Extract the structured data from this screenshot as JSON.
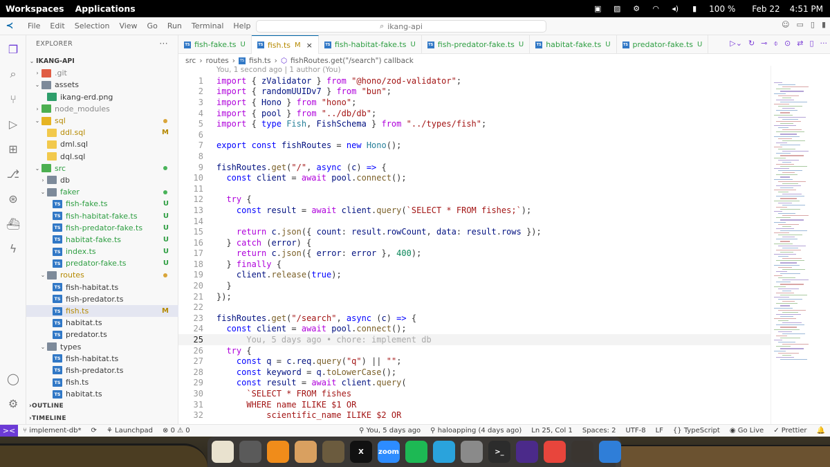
{
  "system_bar": {
    "workspaces": "Workspaces",
    "applications": "Applications",
    "battery": "100 %",
    "date": "Feb 22",
    "time": "4:51 PM",
    "icons": [
      "display-icon",
      "image-icon",
      "gear-icon",
      "wifi-icon",
      "volume-icon",
      "battery-icon"
    ]
  },
  "titlebar": {
    "menus": [
      "File",
      "Edit",
      "Selection",
      "View",
      "Go",
      "Run",
      "Terminal",
      "Help"
    ],
    "search": "ikang-api",
    "icons": [
      "back-arrow-icon",
      "forward-arrow-icon",
      "copilot-icon",
      "layout-icon"
    ]
  },
  "activity_bar": {
    "items": [
      "explorer-icon",
      "search-icon",
      "source-control-icon",
      "run-debug-icon",
      "extensions-icon",
      "git-graph-icon",
      "remote-icon",
      "docker-icon",
      "thunder-icon",
      "account-icon",
      "settings-icon"
    ]
  },
  "explorer": {
    "header": "EXPLORER",
    "menu": "···",
    "root": "IKANG-API",
    "tree": [
      {
        "name": ".git",
        "depth": 1,
        "kind": "folder-red",
        "chevron": "›",
        "status": "",
        "color": "gray"
      },
      {
        "name": "assets",
        "depth": 1,
        "kind": "folder",
        "chevron": "⌄",
        "status": "",
        "color": ""
      },
      {
        "name": "ikang-erd.png",
        "depth": 2,
        "kind": "img",
        "chevron": "",
        "status": "",
        "color": ""
      },
      {
        "name": "node_modules",
        "depth": 1,
        "kind": "folder-green",
        "chevron": "›",
        "status": "",
        "color": "gray"
      },
      {
        "name": "sql",
        "depth": 1,
        "kind": "folder-yellow",
        "chevron": "⌄",
        "status": "dot-yellow",
        "color": "yellow"
      },
      {
        "name": "ddl.sql",
        "depth": 2,
        "kind": "sql",
        "chevron": "",
        "status": "M",
        "color": "yellow"
      },
      {
        "name": "dml.sql",
        "depth": 2,
        "kind": "sql",
        "chevron": "",
        "status": "",
        "color": ""
      },
      {
        "name": "dql.sql",
        "depth": 2,
        "kind": "sql",
        "chevron": "",
        "status": "",
        "color": ""
      },
      {
        "name": "src",
        "depth": 1,
        "kind": "folder-green",
        "chevron": "⌄",
        "status": "dot-green",
        "color": "green"
      },
      {
        "name": "db",
        "depth": 2,
        "kind": "folder",
        "chevron": "›",
        "status": "",
        "color": ""
      },
      {
        "name": "faker",
        "depth": 2,
        "kind": "folder",
        "chevron": "⌄",
        "status": "dot-green",
        "color": "green"
      },
      {
        "name": "fish-fake.ts",
        "depth": 3,
        "kind": "ts",
        "chevron": "",
        "status": "U",
        "color": "green"
      },
      {
        "name": "fish-habitat-fake.ts",
        "depth": 3,
        "kind": "ts",
        "chevron": "",
        "status": "U",
        "color": "green"
      },
      {
        "name": "fish-predator-fake.ts",
        "depth": 3,
        "kind": "ts",
        "chevron": "",
        "status": "U",
        "color": "green"
      },
      {
        "name": "habitat-fake.ts",
        "depth": 3,
        "kind": "ts",
        "chevron": "",
        "status": "U",
        "color": "green"
      },
      {
        "name": "index.ts",
        "depth": 3,
        "kind": "ts",
        "chevron": "",
        "status": "U",
        "color": "green"
      },
      {
        "name": "predator-fake.ts",
        "depth": 3,
        "kind": "ts",
        "chevron": "",
        "status": "U",
        "color": "green"
      },
      {
        "name": "routes",
        "depth": 2,
        "kind": "folder",
        "chevron": "⌄",
        "status": "dot-yellow",
        "color": "yellow"
      },
      {
        "name": "fish-habitat.ts",
        "depth": 3,
        "kind": "ts",
        "chevron": "",
        "status": "",
        "color": ""
      },
      {
        "name": "fish-predator.ts",
        "depth": 3,
        "kind": "ts",
        "chevron": "",
        "status": "",
        "color": ""
      },
      {
        "name": "fish.ts",
        "depth": 3,
        "kind": "ts",
        "chevron": "",
        "status": "M",
        "color": "yellow",
        "selected": true
      },
      {
        "name": "habitat.ts",
        "depth": 3,
        "kind": "ts",
        "chevron": "",
        "status": "",
        "color": ""
      },
      {
        "name": "predator.ts",
        "depth": 3,
        "kind": "ts",
        "chevron": "",
        "status": "",
        "color": ""
      },
      {
        "name": "types",
        "depth": 2,
        "kind": "folder",
        "chevron": "⌄",
        "status": "",
        "color": ""
      },
      {
        "name": "fish-habitat.ts",
        "depth": 3,
        "kind": "ts",
        "chevron": "",
        "status": "",
        "color": ""
      },
      {
        "name": "fish-predator.ts",
        "depth": 3,
        "kind": "ts",
        "chevron": "",
        "status": "",
        "color": ""
      },
      {
        "name": "fish.ts",
        "depth": 3,
        "kind": "ts",
        "chevron": "",
        "status": "",
        "color": ""
      },
      {
        "name": "habitat.ts",
        "depth": 3,
        "kind": "ts",
        "chevron": "",
        "status": "",
        "color": ""
      }
    ],
    "sections": [
      "OUTLINE",
      "TIMELINE"
    ]
  },
  "tabs": [
    {
      "name": "fish-fake.ts",
      "status": "U",
      "active": false
    },
    {
      "name": "fish.ts",
      "status": "M",
      "active": true
    },
    {
      "name": "fish-habitat-fake.ts",
      "status": "U",
      "active": false
    },
    {
      "name": "fish-predator-fake.ts",
      "status": "U",
      "active": false
    },
    {
      "name": "habitat-fake.ts",
      "status": "U",
      "active": false
    },
    {
      "name": "predator-fake.ts",
      "status": "U",
      "active": false
    }
  ],
  "breadcrumb": [
    "src",
    "routes",
    "fish.ts",
    "fishRoutes.get(\"/search\") callback"
  ],
  "editor": {
    "blame_top": "You, 1 second ago | 1 author (You)",
    "current_line": 25,
    "lines": [
      {
        "n": "1",
        "html": "<span class=\"kw2\">import</span> { <span class=\"var\">zValidator</span> } <span class=\"kw2\">from</span> <span class=\"str\">\"@hono/zod-validator\"</span>;"
      },
      {
        "n": "2",
        "html": "<span class=\"kw2\">import</span> { <span class=\"var\">randomUUIDv7</span> } <span class=\"kw2\">from</span> <span class=\"str\">\"bun\"</span>;"
      },
      {
        "n": "3",
        "html": "<span class=\"kw2\">import</span> { <span class=\"var\">Hono</span> } <span class=\"kw2\">from</span> <span class=\"str\">\"hono\"</span>;"
      },
      {
        "n": "4",
        "html": "<span class=\"kw2\">import</span> { <span class=\"var\">pool</span> } <span class=\"kw2\">from</span> <span class=\"str\">\"../db/db\"</span>;"
      },
      {
        "n": "5",
        "html": "<span class=\"kw2\">import</span> { <span class=\"kw\">type</span> <span class=\"cls\">Fish</span>, <span class=\"var\">FishSchema</span> } <span class=\"kw2\">from</span> <span class=\"str\">\"../types/fish\"</span>;"
      },
      {
        "n": "6",
        "html": ""
      },
      {
        "n": "7",
        "html": "<span class=\"kw\">export</span> <span class=\"kw\">const</span> <span class=\"var\">fishRoutes</span> = <span class=\"kw\">new</span> <span class=\"cls\">Hono</span>();"
      },
      {
        "n": "8",
        "html": ""
      },
      {
        "n": "9",
        "html": "<span class=\"var\">fishRoutes</span>.<span class=\"fn\">get</span>(<span class=\"str\">\"/\"</span>, <span class=\"kw\">async</span> (<span class=\"var\">c</span>) <span class=\"kw\">=&gt;</span> {"
      },
      {
        "n": "10",
        "html": "  <span class=\"kw\">const</span> <span class=\"var\">client</span> = <span class=\"kw2\">await</span> <span class=\"var\">pool</span>.<span class=\"fn\">connect</span>();"
      },
      {
        "n": "11",
        "html": ""
      },
      {
        "n": "12",
        "html": "  <span class=\"kw2\">try</span> {"
      },
      {
        "n": "13",
        "html": "    <span class=\"kw\">const</span> <span class=\"var\">result</span> = <span class=\"kw2\">await</span> <span class=\"var\">client</span>.<span class=\"fn\">query</span>(<span class=\"tpl\">`SELECT * FROM fishes;`</span>);"
      },
      {
        "n": "14",
        "html": ""
      },
      {
        "n": "15",
        "html": "    <span class=\"kw2\">return</span> <span class=\"var\">c</span>.<span class=\"fn\">json</span>({ <span class=\"var\">count</span>: <span class=\"var\">result</span>.<span class=\"var\">rowCount</span>, <span class=\"var\">data</span>: <span class=\"var\">result</span>.<span class=\"var\">rows</span> });"
      },
      {
        "n": "16",
        "html": "  } <span class=\"kw2\">catch</span> (<span class=\"var\">error</span>) {"
      },
      {
        "n": "17",
        "html": "    <span class=\"kw2\">return</span> <span class=\"var\">c</span>.<span class=\"fn\">json</span>({ <span class=\"var\">error</span>: <span class=\"var\">error</span> }, <span class=\"num2\">400</span>);"
      },
      {
        "n": "18",
        "html": "  } <span class=\"kw2\">finally</span> {"
      },
      {
        "n": "19",
        "html": "    <span class=\"var\">client</span>.<span class=\"fn\">release</span>(<span class=\"kw\">true</span>);"
      },
      {
        "n": "20",
        "html": "  }"
      },
      {
        "n": "21",
        "html": "});"
      },
      {
        "n": "22",
        "html": ""
      },
      {
        "n": "23",
        "html": "<span class=\"var\">fishRoutes</span>.<span class=\"fn\">get</span>(<span class=\"str\">\"/search\"</span>, <span class=\"kw\">async</span> (<span class=\"var\">c</span>) <span class=\"kw\">=&gt;</span> {"
      },
      {
        "n": "24",
        "html": "  <span class=\"kw\">const</span> <span class=\"var\">client</span> = <span class=\"kw2\">await</span> <span class=\"var\">pool</span>.<span class=\"fn\">connect</span>();"
      },
      {
        "n": "25",
        "html": "      <span class=\"cm\">You, 5 days ago • chore: implement db</span>"
      },
      {
        "n": "26",
        "html": "  <span class=\"kw2\">try</span> {"
      },
      {
        "n": "27",
        "html": "    <span class=\"kw\">const</span> <span class=\"var\">q</span> = <span class=\"var\">c</span>.<span class=\"var\">req</span>.<span class=\"fn\">query</span>(<span class=\"str\">\"q\"</span>) || <span class=\"str\">\"\"</span>;"
      },
      {
        "n": "28",
        "html": "    <span class=\"kw\">const</span> <span class=\"var\">keyword</span> = <span class=\"var\">q</span>.<span class=\"fn\">toLowerCase</span>();"
      },
      {
        "n": "29",
        "html": "    <span class=\"kw\">const</span> <span class=\"var\">result</span> = <span class=\"kw2\">await</span> <span class=\"var\">client</span>.<span class=\"fn\">query</span>("
      },
      {
        "n": "30",
        "html": "      <span class=\"tpl\">`SELECT * FROM fishes</span>"
      },
      {
        "n": "31",
        "html": "      <span class=\"tpl\">WHERE name ILIKE $1 OR</span>"
      },
      {
        "n": "32",
        "html": "          <span class=\"tpl\">scientific_name ILIKE $2 OR</span>"
      }
    ]
  },
  "statusbar": {
    "remote": "><",
    "branch": "implement-db*",
    "sync": "⟳",
    "launchpad": "Launchpad",
    "problems": "⊗ 0 ⚠ 0",
    "ports": "",
    "blame": "You, 5 days ago",
    "author": "haloapping (4 days ago)",
    "position": "Ln 25, Col 1",
    "spaces": "Spaces: 2",
    "encoding": "UTF-8",
    "eol": "LF",
    "language": "TypeScript",
    "golive": "Go Live",
    "prettier": "Prettier"
  },
  "dock": {
    "apps": [
      {
        "name": "text-editor-icon",
        "label": "",
        "color": "#e9e2cf"
      },
      {
        "name": "settings-app-icon",
        "label": "",
        "color": "#5a5a5a"
      },
      {
        "name": "network-app-icon",
        "label": "",
        "color": "#f08c1a"
      },
      {
        "name": "archive-app-icon",
        "label": "",
        "color": "#d9a060"
      },
      {
        "name": "gimp-icon",
        "label": "",
        "color": "#6b5b3e"
      },
      {
        "name": "x-icon",
        "label": "X",
        "color": "#111111"
      },
      {
        "name": "zoom-icon",
        "label": "zoom",
        "color": "#2d8cff"
      },
      {
        "name": "spotify-icon",
        "label": "",
        "color": "#1db954"
      },
      {
        "name": "telegram-icon",
        "label": "",
        "color": "#2aa3dc"
      },
      {
        "name": "files-icon",
        "label": "",
        "color": "#8a8a8a"
      },
      {
        "name": "terminal-icon",
        "label": ">_",
        "color": "#2c2c2c"
      },
      {
        "name": "screen-recorder-icon",
        "label": "",
        "color": "#4b2a8a"
      },
      {
        "name": "chrome-icon",
        "label": "",
        "color": "#e8453c"
      },
      {
        "name": "gnome-icon",
        "label": "",
        "color": "#3a3530"
      },
      {
        "name": "vscode-icon",
        "label": "",
        "color": "#2f7ed8"
      }
    ]
  }
}
